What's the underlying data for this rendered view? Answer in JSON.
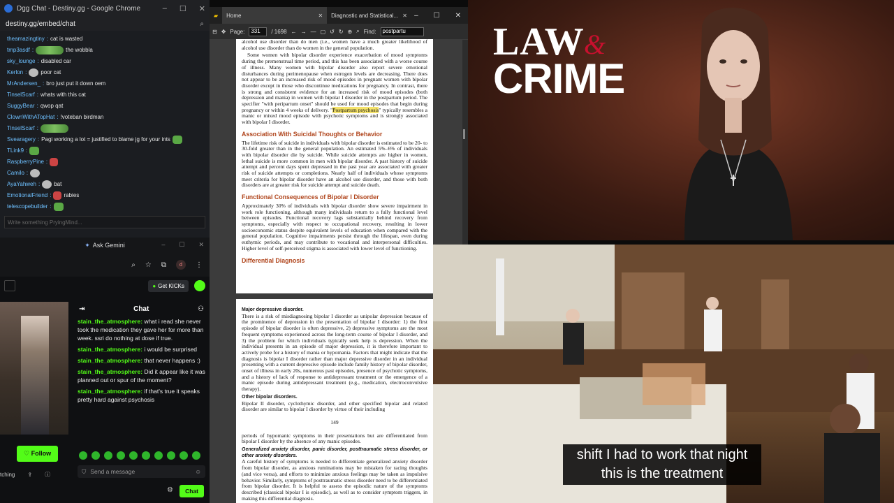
{
  "chrome_window": {
    "title": "Dgg Chat - Destiny.gg - Google Chrome",
    "url": "destiny.gg/embed/chat",
    "input_placeholder": "Write something PryingMind...",
    "messages": [
      {
        "user": "theamazingtiny",
        "text": "cat is wasted",
        "emote": ""
      },
      {
        "user": "tmp3asdf",
        "text": "the wobbla",
        "emote": "wide"
      },
      {
        "user": "sky_lounge",
        "text": "disabled car",
        "emote": ""
      },
      {
        "user": "Kerlon",
        "text": "poor cat",
        "emote": "grey"
      },
      {
        "user": "MrAndersen_",
        "text": "bro just put it down oem",
        "emote": ""
      },
      {
        "user": "TinselScarf",
        "text": "whats with this cat",
        "emote": ""
      },
      {
        "user": "SuggyBear",
        "text": "qwop qat",
        "emote": ""
      },
      {
        "user": "ClownWithATopHat",
        "text": "!voteban birdman",
        "emote": ""
      },
      {
        "user": "TinselScarf",
        "text": "",
        "emote": "wide"
      },
      {
        "user": "Svearagery",
        "text": "Pagi working a lot = justified to blame jg for your ints",
        "emote": "small"
      },
      {
        "user": "TLink9",
        "text": "",
        "emote": "small"
      },
      {
        "user": "RaspberryPine",
        "text": "",
        "emote": "red"
      },
      {
        "user": "Camilo",
        "text": "",
        "emote": "grey"
      },
      {
        "user": "AyaYahweh",
        "text": "bat",
        "emote": "grey"
      },
      {
        "user": "EmotionalFriend",
        "text": "rabies",
        "emote": "red"
      },
      {
        "user": "telescopebuilder",
        "text": "",
        "emote": "small"
      }
    ]
  },
  "kick_window": {
    "gemini_label": "Ask Gemini",
    "avatar_letter": "d",
    "get_kicks": "Get KICKs",
    "chat_title": "Chat",
    "follow_label": "Follow",
    "share_prefix": "tching",
    "send_placeholder": "Send a message",
    "chat_button": "Chat",
    "messages": [
      {
        "user": "stain_the_atmosphere:",
        "text": "what i read she never took the medication they gave her for more than week. ssri do nothing at dose if true."
      },
      {
        "user": "stain_the_atmosphere:",
        "text": "i would be surprised"
      },
      {
        "user": "stain_the_atmosphere:",
        "text": "that never happens :)"
      },
      {
        "user": "stain_the_atmosphere:",
        "text": "Did it appear like it was planned out or spur of the moment?"
      },
      {
        "user": "stain_the_atmosphere:",
        "text": "if that's true it speaks pretty hard against psychosis"
      }
    ]
  },
  "pdf_viewer": {
    "tab_home": "Home",
    "tab_doc": "Diagnostic and Statistical...",
    "page_label": "Page:",
    "page_current": "331",
    "page_total": "/ 1698",
    "find_label": "Find:",
    "find_value": "postpartu",
    "page1": {
      "intro": "alcohol use disorder than do men (i.e., women have a much greater likelihood of alcohol use disorder than do women in the general population.",
      "para1_a": "Some women with bipolar disorder experience exacerbation of mood symptoms during the premenstrual time period, and this has been associated with a worse course of illness. Many women with bipolar disorder also report severe emotional disturbances during perimenopause when estrogen levels are decreasing. There does not appear to be an increased risk of mood episodes in pregnant women with bipolar disorder except in those who discontinue medications for pregnancy. In contrast, there is strong and consistent evidence for an increased risk of mood episodes (both depression and mania) in women with bipolar I disorder in the postpartum period. The specifier \"with peripartum onset\" should be used for mood episodes that begin during pregnancy or within 4 weeks of delivery. \"",
      "para1_hl": "Postpartum psychosis",
      "para1_b": "\" typically resembles a manic or mixed mood episode with psychotic symptoms and is strongly associated with bipolar I disorder.",
      "h_suicide": "Association With Suicidal Thoughts or Behavior",
      "suicide": "The lifetime risk of suicide in individuals with bipolar disorder is estimated to be 20- to 30-fold greater than in the general population. An estimated 5%–6% of individuals with bipolar disorder die by suicide. While suicide attempts are higher in women, lethal suicide is more common in men with bipolar disorder. A past history of suicide attempt and percent days spent depressed in the past year are associated with greater risk of suicide attempts or completions. Nearly half of individuals whose symptoms meet criteria for bipolar disorder have an alcohol use disorder, and those with both disorders are at greater risk for suicide attempt and suicide death.",
      "h_functional": "Functional Consequences of Bipolar I Disorder",
      "functional": "Approximately 30% of individuals with bipolar disorder show severe impairment in work role functioning, although many individuals return to a fully functional level between episodes. Functional recovery lags substantially behind recovery from symptoms, especially with respect to occupational recovery, resulting in lower socioeconomic status despite equivalent levels of education when compared with the general population. Cognitive impairments persist through the lifespan, even during euthymic periods, and may contribute to vocational and interpersonal difficulties. Higher level of self-perceived stigma is associated with lower level of functioning.",
      "h_differential": "Differential Diagnosis"
    },
    "page2": {
      "h_mdd": "Major depressive disorder.",
      "mdd": "There is a risk of misdiagnosing bipolar I disorder as unipolar depression because of the prominence of depression in the presentation of bipolar I disorder: 1) the first episode of bipolar disorder is often depressive, 2) depressive symptoms are the most frequent symptoms experienced across the long-term course of bipolar I disorder, and 3) the problem for which individuals typically seek help is depression. When the individual presents in an episode of major depression, it is therefore important to actively probe for a history of mania or hypomania. Factors that might indicate that the diagnosis is bipolar I disorder rather than major depressive disorder in an individual presenting with a current depressive episode include family history of bipolar disorder, onset of illness in early 20s, numerous past episodes, presence of psychotic symptoms, and a history of lack of response to antidepressant treatment or the emergence of a manic episode during antidepressant treatment (e.g., medication, electroconvulsive therapy).",
      "h_other": "Other bipolar disorders.",
      "other": "Bipolar II disorder, cyclothymic disorder, and other specified bipolar and related disorder are similar to bipolar I disorder by virtue of their including",
      "page_number": "149",
      "hypo": "periods of hypomanic symptoms in their presentations but are differentiated from bipolar I disorder by the absence of any manic episodes.",
      "h_anx": "Generalized anxiety disorder, panic disorder, posttraumatic stress disorder, or other anxiety disorders.",
      "anx": "A careful history of symptoms is needed to differentiate generalized anxiety disorder from bipolar disorder, as anxious ruminations may be mistaken for racing thoughts (and vice versa), and efforts to minimize anxious feelings may be taken as impulsive behavior. Similarly, symptoms of posttraumatic stress disorder need to be differentiated from bipolar disorder. It is helpful to assess the episodic nature of the symptoms described (classical bipolar I is episodic), as well as to consider symptom triggers, in making this differential diagnosis."
    }
  },
  "law_crime": {
    "logo_word1": "LAW",
    "logo_amp": "&",
    "logo_word2": "CRIME",
    "brand_red": "#c8102e"
  },
  "courtroom": {
    "subtitle_line1": "shift I had to work that night",
    "subtitle_line2": "this is the treatment"
  }
}
